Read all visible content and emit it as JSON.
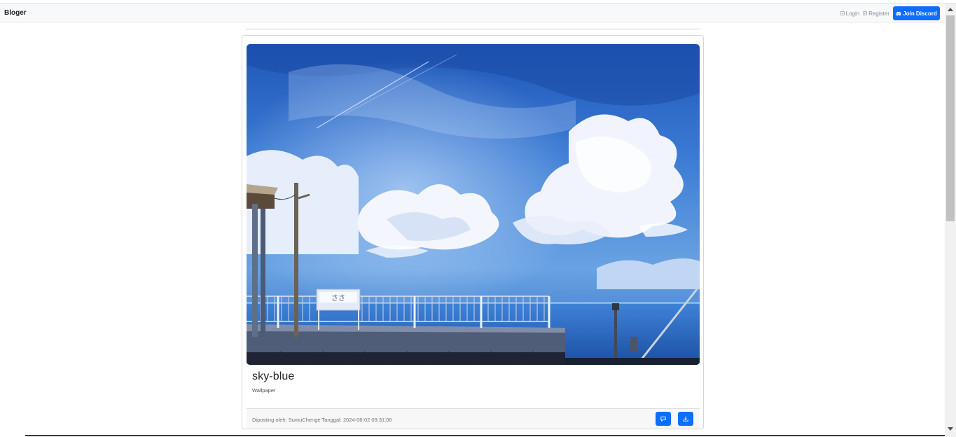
{
  "navbar": {
    "brand": "Bloger",
    "login_label": "Login",
    "register_label": "Register",
    "discord_label": "Join Discord",
    "accent": "#0d6efd"
  },
  "post": {
    "image_alt": "sky-blue",
    "title": "sky-blue",
    "category": "Wallpaper",
    "meta": "Diposting oleh: SumuChenge Tanggal: 2024-06-02 09:31:06",
    "comment_icon": "chat-icon",
    "download_icon": "download-icon"
  }
}
